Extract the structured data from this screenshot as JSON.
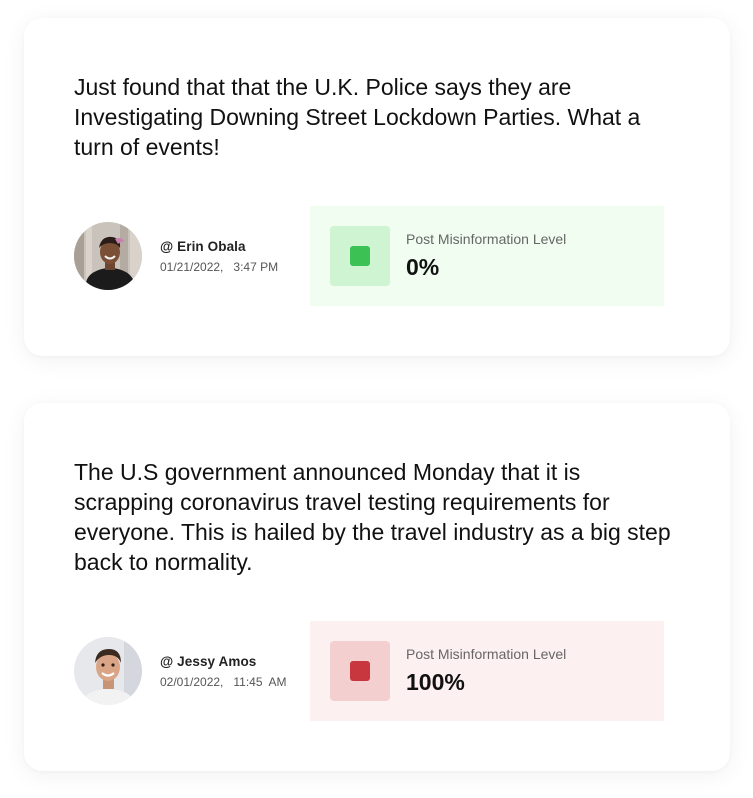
{
  "posts": [
    {
      "text": "Just found that that the U.K. Police says they are Investigating Downing Street Lockdown Parties. What a turn of events!",
      "author": {
        "handle": "@ Erin Obala",
        "date_time": "01/21/2022,   3:47 PM"
      },
      "misinformation": {
        "label": "Post Misinformation Level",
        "value": "0%",
        "level_fraction": 0.0,
        "color": "#3cc154"
      }
    },
    {
      "text": "The U.S government announced Monday that it is scrapping coronavirus travel testing requirements for everyone. This is hailed by the travel industry as a big step back to normality.",
      "author": {
        "handle": "@ Jessy Amos",
        "date_time": "02/01/2022,   11:45  AM"
      },
      "misinformation": {
        "label": "Post Misinformation Level",
        "value": "100%",
        "level_fraction": 1.0,
        "color": "#c8373d"
      }
    }
  ]
}
